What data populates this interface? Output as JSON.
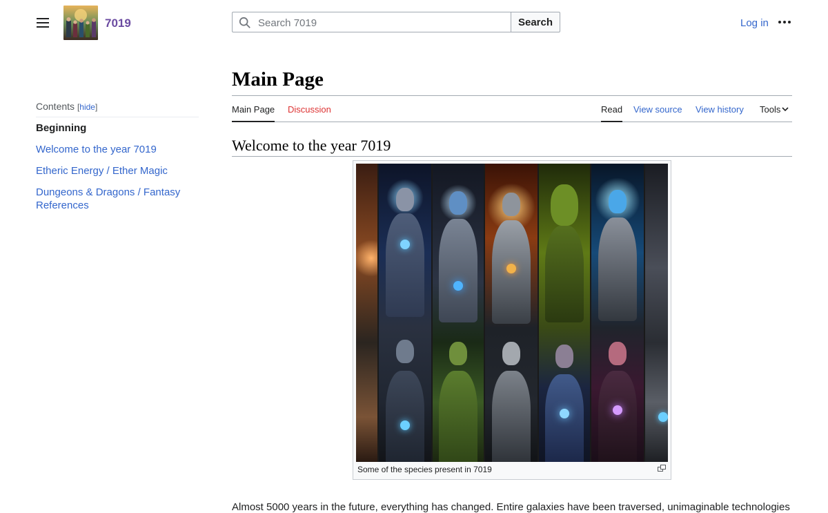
{
  "header": {
    "site_name": "7019",
    "search_placeholder": "Search 7019",
    "search_button": "Search",
    "login": "Log in"
  },
  "toc": {
    "title": "Contents",
    "hide_label": "hide",
    "items": [
      {
        "label": "Beginning"
      },
      {
        "label": "Welcome to the year 7019"
      },
      {
        "label": "Etheric Energy / Ether Magic"
      },
      {
        "label": "Dungeons & Dragons / Fantasy References"
      }
    ]
  },
  "page": {
    "title": "Main Page",
    "tabs": {
      "main_page": "Main Page",
      "discussion": "Discussion",
      "read": "Read",
      "view_source": "View source",
      "view_history": "View history",
      "tools": "Tools"
    },
    "section_heading": "Welcome to the year 7019",
    "thumb_caption": "Some of the species present in 7019",
    "body_text": "Almost 5000 years in the future, everything has changed. Entire galaxies have been traversed, unimaginable technologies"
  },
  "colors": {
    "link": "#3366cc",
    "new_link": "#dd3333",
    "site_name": "#6b4ba1"
  },
  "icons": [
    "menu-icon",
    "search-icon",
    "more-icon",
    "chevron-down-icon",
    "magnify-icon"
  ]
}
